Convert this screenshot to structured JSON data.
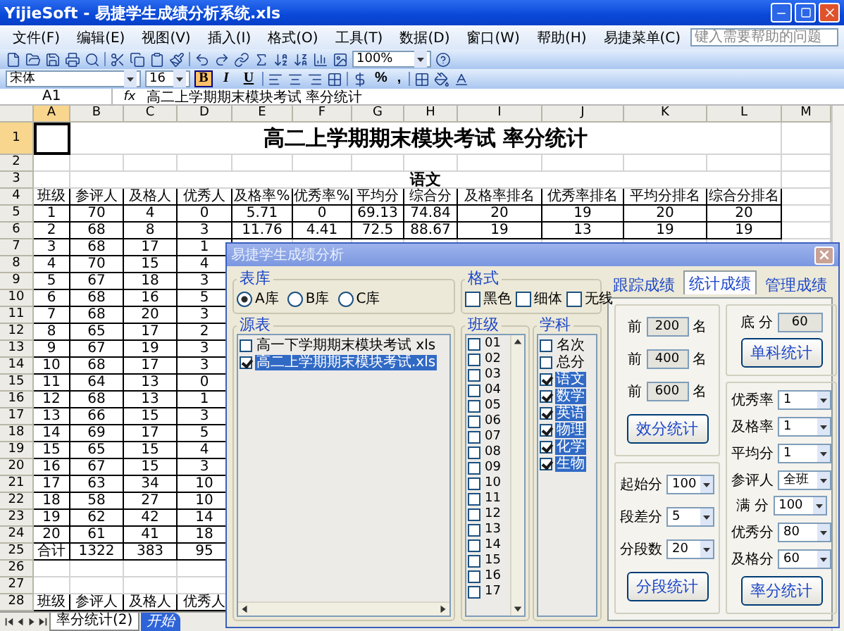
{
  "window": {
    "title": "YijieSoft - 易捷学生成绩分析系统.xls"
  },
  "menu": [
    "文件(F)",
    "编辑(E)",
    "视图(V)",
    "插入(I)",
    "格式(O)",
    "工具(T)",
    "数据(D)",
    "窗口(W)",
    "帮助(H)",
    "易捷菜单(C)"
  ],
  "help_box": {
    "placeholder": "键入需要帮助的问题"
  },
  "toolbar": {
    "zoom": "100%",
    "font": "宋体",
    "font_size": "16",
    "format_buttons": [
      {
        "label": "B",
        "selected": true
      },
      {
        "label": "I",
        "selected": false
      },
      {
        "label": "U",
        "selected": false
      }
    ],
    "number_buttons": [
      "%",
      ","
    ]
  },
  "formula_bar": {
    "cell": "A1",
    "fx": "fx",
    "value": "高二上学期期末模块考试 率分统计"
  },
  "sheet": {
    "columns": [
      {
        "label": "A",
        "selected": true
      },
      {
        "label": "B",
        "selected": false
      },
      {
        "label": "C",
        "selected": false
      },
      {
        "label": "D",
        "selected": false
      },
      {
        "label": "E",
        "selected": false
      },
      {
        "label": "F",
        "selected": false
      },
      {
        "label": "G",
        "selected": false
      },
      {
        "label": "H",
        "selected": false
      },
      {
        "label": "I",
        "selected": false
      },
      {
        "label": "J",
        "selected": false
      },
      {
        "label": "K",
        "selected": false
      },
      {
        "label": "L",
        "selected": false
      },
      {
        "label": "M",
        "selected": false
      }
    ],
    "rows": [
      {
        "number": "1",
        "selected": true,
        "kind": "title",
        "text": "高二上学期期末模块考试  率分统计"
      },
      {
        "number": "2",
        "selected": false,
        "kind": "blank"
      },
      {
        "number": "3",
        "selected": false,
        "kind": "subject",
        "text": "语文"
      },
      {
        "number": "4",
        "selected": false,
        "kind": "data",
        "cells": [
          "班级",
          "参评人",
          "及格人",
          "优秀人",
          "及格率%",
          "优秀率%",
          "平均分",
          "综合分",
          "及格率排名",
          "优秀率排名",
          "平均分排名",
          "综合分排名"
        ]
      },
      {
        "number": "5",
        "selected": false,
        "kind": "data",
        "cells": [
          "1",
          "70",
          "4",
          "0",
          "5.71",
          "0",
          "69.13",
          "74.84",
          "20",
          "19",
          "20",
          "20"
        ]
      },
      {
        "number": "6",
        "selected": false,
        "kind": "data",
        "cells": [
          "2",
          "68",
          "8",
          "3",
          "11.76",
          "4.41",
          "72.5",
          "88.67",
          "19",
          "13",
          "19",
          "19"
        ]
      },
      {
        "number": "7",
        "selected": false,
        "kind": "data",
        "cells": [
          "3",
          "68",
          "17",
          "1"
        ]
      },
      {
        "number": "8",
        "selected": false,
        "kind": "data",
        "cells": [
          "4",
          "70",
          "15",
          "4"
        ]
      },
      {
        "number": "9",
        "selected": false,
        "kind": "data",
        "cells": [
          "5",
          "67",
          "18",
          "3"
        ]
      },
      {
        "number": "10",
        "selected": false,
        "kind": "data",
        "cells": [
          "6",
          "68",
          "16",
          "5"
        ]
      },
      {
        "number": "11",
        "selected": false,
        "kind": "data",
        "cells": [
          "7",
          "68",
          "20",
          "3"
        ]
      },
      {
        "number": "12",
        "selected": false,
        "kind": "data",
        "cells": [
          "8",
          "65",
          "17",
          "2"
        ]
      },
      {
        "number": "13",
        "selected": false,
        "kind": "data",
        "cells": [
          "9",
          "67",
          "19",
          "3"
        ]
      },
      {
        "number": "14",
        "selected": false,
        "kind": "data",
        "cells": [
          "10",
          "68",
          "17",
          "3"
        ]
      },
      {
        "number": "15",
        "selected": false,
        "kind": "data",
        "cells": [
          "11",
          "64",
          "13",
          "0"
        ]
      },
      {
        "number": "16",
        "selected": false,
        "kind": "data",
        "cells": [
          "12",
          "68",
          "13",
          "1"
        ]
      },
      {
        "number": "17",
        "selected": false,
        "kind": "data",
        "cells": [
          "13",
          "66",
          "15",
          "3"
        ]
      },
      {
        "number": "18",
        "selected": false,
        "kind": "data",
        "cells": [
          "14",
          "69",
          "17",
          "5"
        ]
      },
      {
        "number": "19",
        "selected": false,
        "kind": "data",
        "cells": [
          "15",
          "65",
          "15",
          "4"
        ]
      },
      {
        "number": "20",
        "selected": false,
        "kind": "data",
        "cells": [
          "16",
          "67",
          "15",
          "3"
        ]
      },
      {
        "number": "21",
        "selected": false,
        "kind": "data",
        "cells": [
          "17",
          "63",
          "34",
          "10"
        ]
      },
      {
        "number": "22",
        "selected": false,
        "kind": "data",
        "cells": [
          "18",
          "58",
          "27",
          "10"
        ]
      },
      {
        "number": "23",
        "selected": false,
        "kind": "data",
        "cells": [
          "19",
          "62",
          "42",
          "14"
        ]
      },
      {
        "number": "24",
        "selected": false,
        "kind": "data",
        "cells": [
          "20",
          "61",
          "41",
          "18"
        ]
      },
      {
        "number": "25",
        "selected": false,
        "kind": "data",
        "cells": [
          "合计",
          "1322",
          "383",
          "95"
        ]
      },
      {
        "number": "26",
        "selected": false,
        "kind": "blank"
      },
      {
        "number": "27",
        "selected": false,
        "kind": "blank"
      },
      {
        "number": "28",
        "selected": false,
        "kind": "data",
        "cells": [
          "班级",
          "参评人",
          "及格人",
          "优秀人"
        ]
      }
    ]
  },
  "sheet_tabs": [
    {
      "label": "率分统计(2)",
      "selected": false
    },
    {
      "label": "开始",
      "selected": true
    }
  ],
  "dialog": {
    "title": "易捷学生成绩分析",
    "library": {
      "label": "表库",
      "options": [
        {
          "label": "A库",
          "selected": true
        },
        {
          "label": "B库",
          "selected": false
        },
        {
          "label": "C库",
          "selected": false
        }
      ]
    },
    "format": {
      "label": "格式",
      "options": [
        {
          "label": "黑色",
          "checked": false
        },
        {
          "label": "细体",
          "checked": false
        },
        {
          "label": "无线",
          "checked": false
        }
      ]
    },
    "source": {
      "label": "源表",
      "items": [
        {
          "label": "高一下学期期末模块考试 xls",
          "checked": false,
          "selected": false
        },
        {
          "label": "高二上学期期末模块考试.xls",
          "checked": true,
          "selected": true
        }
      ]
    },
    "classes": {
      "label": "班级",
      "items": [
        {
          "label": "01",
          "checked": false
        },
        {
          "label": "02",
          "checked": false
        },
        {
          "label": "03",
          "checked": false
        },
        {
          "label": "04",
          "checked": false
        },
        {
          "label": "05",
          "checked": false
        },
        {
          "label": "06",
          "checked": false
        },
        {
          "label": "07",
          "checked": false
        },
        {
          "label": "08",
          "checked": false
        },
        {
          "label": "09",
          "checked": false
        },
        {
          "label": "10",
          "checked": false
        },
        {
          "label": "11",
          "checked": false
        },
        {
          "label": "12",
          "checked": false
        },
        {
          "label": "13",
          "checked": false
        },
        {
          "label": "14",
          "checked": false
        },
        {
          "label": "15",
          "checked": false
        },
        {
          "label": "16",
          "checked": false
        },
        {
          "label": "17",
          "checked": false
        }
      ]
    },
    "subjects": {
      "label": "学科",
      "items": [
        {
          "label": "名次",
          "checked": false,
          "selected": false
        },
        {
          "label": "总分",
          "checked": false,
          "selected": false
        },
        {
          "label": "语文",
          "checked": true,
          "selected": true
        },
        {
          "label": "数学",
          "checked": true,
          "selected": true
        },
        {
          "label": "英语",
          "checked": true,
          "selected": true
        },
        {
          "label": "物理",
          "checked": true,
          "selected": true
        },
        {
          "label": "化学",
          "checked": true,
          "selected": true
        },
        {
          "label": "生物",
          "checked": true,
          "selected": true
        }
      ]
    },
    "tabs": [
      {
        "label": "跟踪成绩",
        "selected": false
      },
      {
        "label": "统计成绩",
        "selected": true
      },
      {
        "label": "管理成绩",
        "selected": false
      }
    ],
    "top_n": {
      "rows": [
        {
          "prefix": "前",
          "value": "200",
          "suffix": "名"
        },
        {
          "prefix": "前",
          "value": "400",
          "suffix": "名"
        },
        {
          "prefix": "前",
          "value": "600",
          "suffix": "名"
        }
      ],
      "button": "效分统计"
    },
    "single": {
      "label": "底 分",
      "value": "60",
      "button": "单科统计"
    },
    "segment": {
      "fields": [
        {
          "label": "起始分",
          "value": "100"
        },
        {
          "label": "段差分",
          "value": "5"
        },
        {
          "label": "分段数",
          "value": "20"
        }
      ],
      "button": "分段统计"
    },
    "rate": {
      "fields": [
        {
          "label": "优秀率",
          "value": "1"
        },
        {
          "label": "及格率",
          "value": "1"
        },
        {
          "label": "平均分",
          "value": "1"
        },
        {
          "label": "参评人",
          "value": "全班"
        },
        {
          "label": "满 分",
          "value": "100"
        },
        {
          "label": "优秀分",
          "value": "80"
        },
        {
          "label": "及格分",
          "value": "60"
        }
      ],
      "button": "率分统计"
    }
  }
}
